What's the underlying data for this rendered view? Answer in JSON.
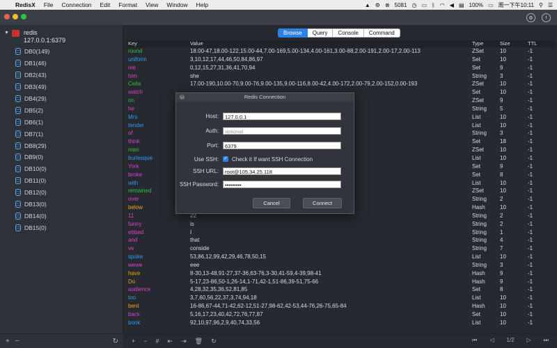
{
  "menubar": {
    "apple": "",
    "items": [
      "RedisX",
      "File",
      "Connection",
      "Edit",
      "Format",
      "View",
      "Window",
      "Help"
    ],
    "status": {
      "number": "5081",
      "battery": "100%",
      "datetime": "周一下午10:11"
    }
  },
  "sidebar": {
    "server_name": "redis",
    "server_addr": "127.0.0.1:6379",
    "dbs": [
      "DB0(149)",
      "DB1(46)",
      "DB2(43)",
      "DB3(49)",
      "DB4(29)",
      "DB5(2)",
      "DB6(1)",
      "DB7(1)",
      "DB8(29)",
      "DB9(0)",
      "DB10(0)",
      "DB11(0)",
      "DB12(0)",
      "DB13(0)",
      "DB14(0)",
      "DB15(0)"
    ],
    "footer": [
      "+",
      "−",
      "↻"
    ]
  },
  "tabs": [
    "Browse",
    "Query",
    "Console",
    "Command"
  ],
  "table": {
    "headers": [
      "Key",
      "Value",
      "Type",
      "Size",
      "TTL"
    ],
    "rows": [
      {
        "key": "round",
        "color": "#2fc04a",
        "value": "18.00-47,18.00-122,15.00-44,7.00-169,5.00-134,4.00-161,3.00-88,2.00-191,2.00-17,2.00-113",
        "type": "ZSet",
        "size": "10",
        "ttl": "-1"
      },
      {
        "key": "uniform",
        "color": "#2d9bf0",
        "value": "3,10,12,17,44,46,50,84,86,97",
        "type": "Set",
        "size": "10",
        "ttl": "-1"
      },
      {
        "key": "me",
        "color": "#e040c8",
        "value": "0,12,15,27,31,36,41,70,94",
        "type": "Set",
        "size": "9",
        "ttl": "-1"
      },
      {
        "key": "him",
        "color": "#e040c8",
        "value": "she",
        "type": "String",
        "size": "3",
        "ttl": "-1"
      },
      {
        "key": "Celia",
        "color": "#2fc04a",
        "value": "17.00-190,10.00-70,9.00-76,9.00-135,9.00-116,8.00-42,4.00-172,2.00-79,2.00-152,0.00-193",
        "type": "ZSet",
        "size": "10",
        "ttl": "-1"
      },
      {
        "key": "watch",
        "color": "#d63fd6",
        "value": "",
        "type": "Set",
        "size": "10",
        "ttl": "-1"
      },
      {
        "key": "on",
        "color": "#2fc04a",
        "value": "...188,5.00-114,3.00-137",
        "type": "ZSet",
        "size": "9",
        "ttl": "-1"
      },
      {
        "key": "he",
        "color": "#e040c8",
        "value": "",
        "type": "String",
        "size": "5",
        "ttl": "-1"
      },
      {
        "key": "Mrs",
        "color": "#2d9bf0",
        "value": "",
        "type": "List",
        "size": "10",
        "ttl": "-1"
      },
      {
        "key": "tender",
        "color": "#2d9bf0",
        "value": "",
        "type": "List",
        "size": "10",
        "ttl": "-1"
      },
      {
        "key": "of",
        "color": "#e040c8",
        "value": "",
        "type": "String",
        "size": "3",
        "ttl": "-1"
      },
      {
        "key": "think",
        "color": "#d63fd6",
        "value": "",
        "type": "Set",
        "size": "18",
        "ttl": "-1"
      },
      {
        "key": "man",
        "color": "#2fc04a",
        "value": "...4.00-57,4.00-144,2.00-33,2.00-139",
        "type": "ZSet",
        "size": "10",
        "ttl": "-1"
      },
      {
        "key": "burlesque",
        "color": "#2d9bf0",
        "value": "",
        "type": "List",
        "size": "10",
        "ttl": "-1"
      },
      {
        "key": "York",
        "color": "#d63fd6",
        "value": "",
        "type": "Set",
        "size": "9",
        "ttl": "-1"
      },
      {
        "key": "broke",
        "color": "#d63fd6",
        "value": "",
        "type": "Set",
        "size": "8",
        "ttl": "-1"
      },
      {
        "key": "with",
        "color": "#2d9bf0",
        "value": "",
        "type": "List",
        "size": "10",
        "ttl": "-1"
      },
      {
        "key": "remained",
        "color": "#2fc04a",
        "value": "...-17,1.00-86,1.00-34,0.00-119",
        "type": "ZSet",
        "size": "10",
        "ttl": "-1"
      },
      {
        "key": "over",
        "color": "#e040c8",
        "value": "",
        "type": "String",
        "size": "2",
        "ttl": "-1"
      },
      {
        "key": "below",
        "color": "#f0a020",
        "value": "...0",
        "type": "Hash",
        "size": "10",
        "ttl": "-1"
      },
      {
        "key": "11",
        "color": "#e040c8",
        "value": "22",
        "type": "String",
        "size": "2",
        "ttl": "-1"
      },
      {
        "key": "funny",
        "color": "#e040c8",
        "value": "is",
        "type": "String",
        "size": "2",
        "ttl": "-1"
      },
      {
        "key": "ebbed",
        "color": "#e040c8",
        "value": "I",
        "type": "String",
        "size": "1",
        "ttl": "-1"
      },
      {
        "key": "and",
        "color": "#e040c8",
        "value": "that",
        "type": "String",
        "size": "4",
        "ttl": "-1"
      },
      {
        "key": "ve",
        "color": "#e040c8",
        "value": "conside",
        "type": "String",
        "size": "7",
        "ttl": "-1"
      },
      {
        "key": "spoke",
        "color": "#2d9bf0",
        "value": "53,86,12,99,42,29,46,78,50,15",
        "type": "List",
        "size": "10",
        "ttl": "-1"
      },
      {
        "key": "wewe",
        "color": "#e040c8",
        "value": "eee",
        "type": "String",
        "size": "3",
        "ttl": "-1"
      },
      {
        "key": "have",
        "color": "#f0a020",
        "value": "8-30,13-48,91-27,37-36,63-76,3-30,41-59,4-39,98-41",
        "type": "Hash",
        "size": "9",
        "ttl": "-1"
      },
      {
        "key": "Do",
        "color": "#f0a020",
        "value": "5-17,23-86,50-1,26-14,1-71,42-1,51-86,39-51,75-66",
        "type": "Hash",
        "size": "9",
        "ttl": "-1"
      },
      {
        "key": "audience",
        "color": "#d63fd6",
        "value": "4,28,32,35,36,52,81,85",
        "type": "Set",
        "size": "8",
        "ttl": "-1"
      },
      {
        "key": "too",
        "color": "#2d9bf0",
        "value": "3,7,60,56,22,37,3,74,94,18",
        "type": "List",
        "size": "10",
        "ttl": "-1"
      },
      {
        "key": "bent",
        "color": "#f0a020",
        "value": "16-86,67-44,71-42,62-12,51-27,98-62,42-53,44-76,26-75,65-84",
        "type": "Hash",
        "size": "10",
        "ttl": "-1"
      },
      {
        "key": "back",
        "color": "#d63fd6",
        "value": "5,16,17,23,40,42,72,76,77,87",
        "type": "Set",
        "size": "10",
        "ttl": "-1"
      },
      {
        "key": "book",
        "color": "#2d9bf0",
        "value": "92,10,97,96,2,9,40,74,33,56",
        "type": "List",
        "size": "10",
        "ttl": "-1"
      }
    ],
    "pager": {
      "first": "⏮",
      "prev": "◁",
      "page": "1/2",
      "next": "▷",
      "last": "⏭"
    },
    "footer": [
      "+",
      "−",
      "#",
      "⇤",
      "⇥",
      "🗑",
      "↻"
    ]
  },
  "dialog": {
    "title": "Redis Connection",
    "host_label": "Host:",
    "host_value": "127.0.0.1",
    "auth_label": "Auth:",
    "auth_placeholder": "optional",
    "port_label": "Port:",
    "port_value": "6379",
    "ssh_label": "Use SSH:",
    "ssh_check_label": "Check it If want SSH  Connection",
    "ssh_url_label": "SSH URL:",
    "ssh_url_value": "root@105.34.25.118",
    "ssh_pw_label": "SSH Password:",
    "ssh_pw_value": "•••••••••",
    "cancel": "Cancel",
    "connect": "Connect"
  }
}
